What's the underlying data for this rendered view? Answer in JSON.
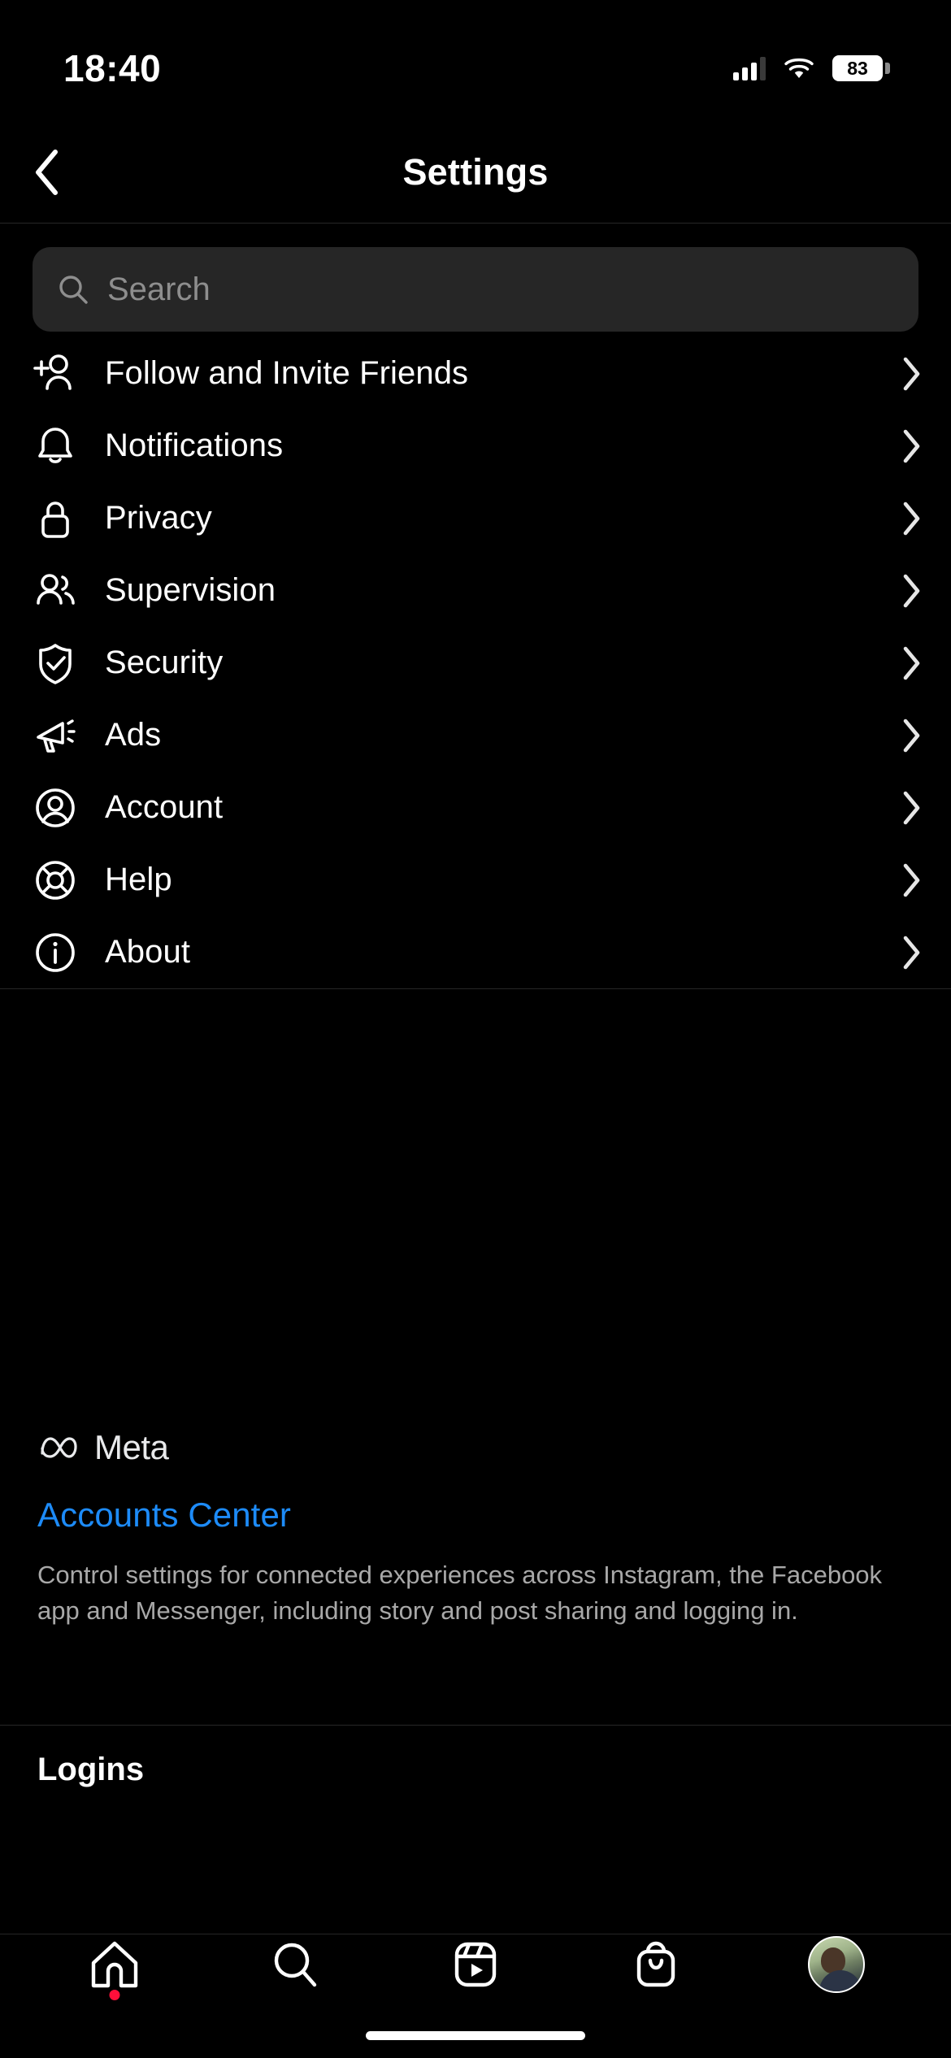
{
  "status_bar": {
    "time": "18:40",
    "battery_percent": "83",
    "cellular_icon": "cellular-bars-icon",
    "wifi_icon": "wifi-icon"
  },
  "header": {
    "title": "Settings",
    "back_icon": "chevron-left-icon"
  },
  "search": {
    "placeholder": "Search",
    "value": "",
    "icon": "search-icon"
  },
  "menu": {
    "items": [
      {
        "label": "Follow and Invite Friends",
        "icon": "person-add-icon",
        "chevron": "chevron-right-icon"
      },
      {
        "label": "Notifications",
        "icon": "bell-icon",
        "chevron": "chevron-right-icon"
      },
      {
        "label": "Privacy",
        "icon": "lock-icon",
        "chevron": "chevron-right-icon"
      },
      {
        "label": "Supervision",
        "icon": "people-icon",
        "chevron": "chevron-right-icon"
      },
      {
        "label": "Security",
        "icon": "shield-check-icon",
        "chevron": "chevron-right-icon"
      },
      {
        "label": "Ads",
        "icon": "megaphone-icon",
        "chevron": "chevron-right-icon"
      },
      {
        "label": "Account",
        "icon": "account-circle-icon",
        "chevron": "chevron-right-icon"
      },
      {
        "label": "Help",
        "icon": "lifebuoy-icon",
        "chevron": "chevron-right-icon"
      },
      {
        "label": "About",
        "icon": "info-circle-icon",
        "chevron": "chevron-right-icon"
      }
    ]
  },
  "meta_section": {
    "brand": "Meta",
    "brand_icon": "meta-infinity-logo",
    "link": "Accounts Center",
    "link_color": "#1d8bf8",
    "description": "Control settings for connected experiences across Instagram, the Facebook app and Messenger, including story and post sharing and logging in."
  },
  "logins_section": {
    "title": "Logins"
  },
  "tab_bar": {
    "tabs": [
      {
        "name": "home",
        "icon": "home-icon",
        "has_badge": true
      },
      {
        "name": "search",
        "icon": "search-icon",
        "has_badge": false
      },
      {
        "name": "reels",
        "icon": "reels-icon",
        "has_badge": false
      },
      {
        "name": "shop",
        "icon": "shopping-bag-icon",
        "has_badge": false
      },
      {
        "name": "profile",
        "icon": "profile-avatar",
        "has_badge": false
      }
    ],
    "badge_color": "#ff0f3a"
  }
}
